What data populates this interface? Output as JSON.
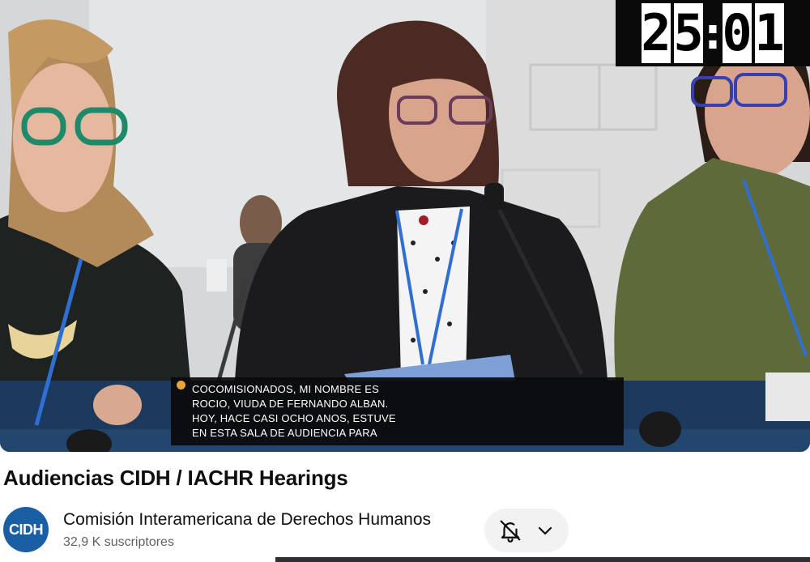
{
  "video": {
    "timer": {
      "d1": "2",
      "d2": "5",
      "d3": "0",
      "d4": "1"
    },
    "captions": {
      "lines": [
        "COCOMISIONADOS, MI NOMBRE ES",
        "ROCIO, VIUDA DE FERNANDO ALBAN.",
        "HOY, HACE CASI OCHO ANOS, ESTUVE",
        "EN ESTA SALA DE AUDIENCIA PARA"
      ]
    }
  },
  "title": "Audiencias CIDH / IACHR Hearings",
  "channel": {
    "avatar_text": "CIDH",
    "name": "Comisión Interamericana de Derechos Humanos",
    "subscribers": "32,9 K suscriptores"
  },
  "icons": {
    "notifications": "bell-off-icon",
    "dropdown": "chevron-down-icon"
  },
  "colors": {
    "avatar": "#1a5fa3",
    "lanyard": "#2f6fd1",
    "caption_bg": "#0a0a0a"
  }
}
